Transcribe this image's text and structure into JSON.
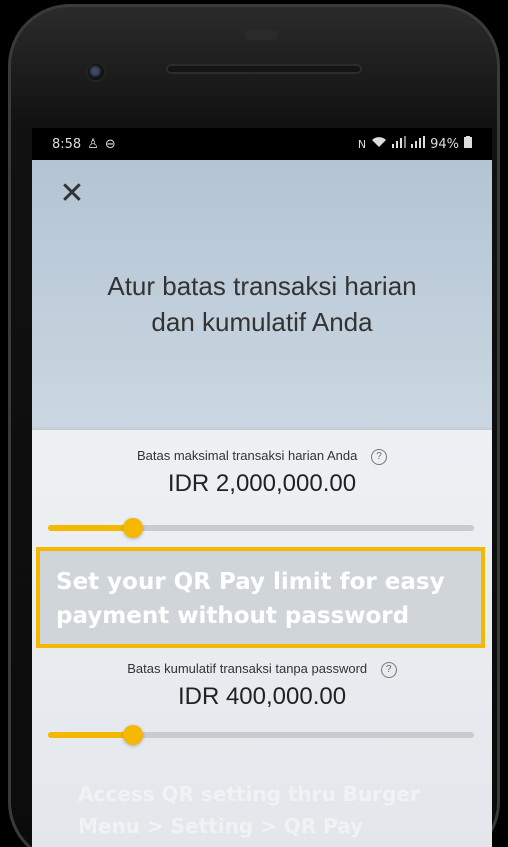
{
  "status_bar": {
    "time": "8:58",
    "left_icons": [
      "person-icon",
      "dnd-icon"
    ],
    "right_icons": [
      "nfc-icon",
      "wifi-icon",
      "signal-icon",
      "signal-icon"
    ],
    "battery": "94%"
  },
  "heading": {
    "line1": "Atur batas transaksi harian",
    "line2": "dan kumulatif Anda"
  },
  "daily_limit": {
    "label": "Batas maksimal transaksi harian Anda",
    "value": "IDR 2,000,000.00",
    "slider_fraction": 0.2
  },
  "cumulative_limit": {
    "label": "Batas kumulatif transaksi tanpa password",
    "value": "IDR 400,000.00",
    "slider_fraction": 0.2
  },
  "callout": {
    "line1": "Set your QR Pay limit for easy",
    "line2": "payment without password"
  },
  "footer": {
    "line1": "Access QR setting thru Burger",
    "line2": "Menu > Setting > QR Pay"
  },
  "colors": {
    "accent": "#f5b800",
    "track": "#c8ccd0"
  }
}
